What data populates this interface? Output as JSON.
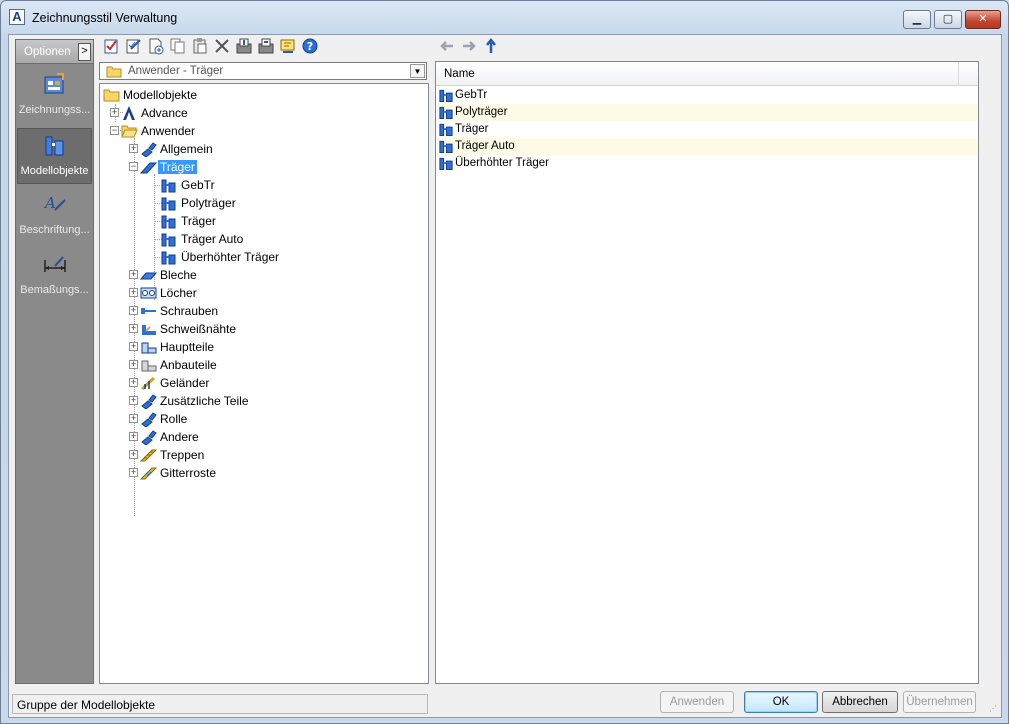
{
  "window": {
    "title": "Zeichnungsstil Verwaltung",
    "buttons": {
      "minimize": "▁",
      "maximize": "▢",
      "close": "✕"
    }
  },
  "options": {
    "header": "Optionen",
    "expand": ">",
    "items": [
      {
        "label": "Zeichnungss...",
        "icon": "drawing-styles-icon",
        "active": false
      },
      {
        "label": "Modellobjekte",
        "icon": "model-objects-icon",
        "active": true
      },
      {
        "label": "Beschriftung...",
        "icon": "labeling-icon",
        "active": false
      },
      {
        "label": "Bemaßungs...",
        "icon": "dimension-icon",
        "active": false
      }
    ]
  },
  "toolbar": {
    "buttons": [
      "check-icon",
      "edit-icon",
      "new-icon",
      "copy-icon",
      "paste-icon",
      "delete-icon",
      "import-icon",
      "export-icon",
      "update-icon",
      "help-icon"
    ],
    "nav": [
      "back-arrow-icon",
      "forward-arrow-icon",
      "up-arrow-icon"
    ]
  },
  "combo": {
    "value": "Anwender - Träger"
  },
  "tree": {
    "root": "Modellobjekte",
    "advance": "Advance",
    "anwender": "Anwender",
    "allgemein": "Allgemein",
    "traeger": "Träger",
    "children": [
      "GebTr",
      "Polyträger",
      "Träger",
      "Träger Auto",
      "Überhöhter Träger"
    ],
    "groups": [
      "Bleche",
      "Löcher",
      "Schrauben",
      "Schweißnähte",
      "Hauptteile",
      "Anbauteile",
      "Geländer",
      "Zusätzliche Teile",
      "Rolle",
      "Andere",
      "Treppen",
      "Gitterroste"
    ]
  },
  "list": {
    "header": "Name",
    "rows": [
      "GebTr",
      "Polyträger",
      "Träger",
      "Träger Auto",
      "Überhöhter Träger"
    ]
  },
  "status": {
    "text": "Gruppe der Modellobjekte"
  },
  "buttons": {
    "apply": "Anwenden",
    "ok": "OK",
    "cancel": "Abbrechen",
    "take": "Übernehmen"
  }
}
